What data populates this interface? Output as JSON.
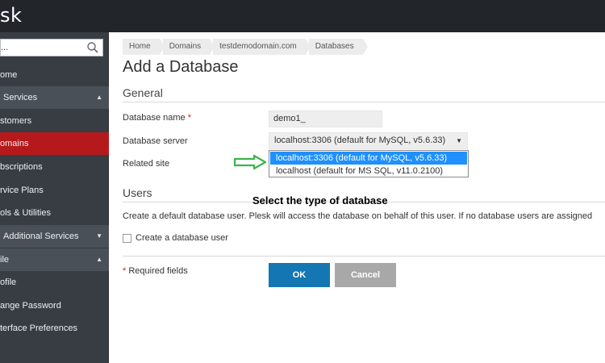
{
  "app": {
    "logo_text": "sk"
  },
  "sidebar": {
    "search": {
      "value": "...",
      "icon": "search-icon"
    },
    "items": [
      {
        "label": "ome",
        "type": "item",
        "active": false
      },
      {
        "label": "Services",
        "type": "group",
        "expanded": true
      },
      {
        "label": "stomers",
        "type": "item",
        "active": false
      },
      {
        "label": "omains",
        "type": "item",
        "active": true
      },
      {
        "label": "bscriptions",
        "type": "item",
        "active": false
      },
      {
        "label": "rvice Plans",
        "type": "item",
        "active": false
      },
      {
        "label": "ols & Utilities",
        "type": "item",
        "active": false
      },
      {
        "label": "Additional Services",
        "type": "group",
        "expanded": false
      },
      {
        "label": "ile",
        "type": "group",
        "expanded": true
      },
      {
        "label": "ofile",
        "type": "item",
        "active": false
      },
      {
        "label": "ange Password",
        "type": "item",
        "active": false
      },
      {
        "label": "terface Preferences",
        "type": "item",
        "active": false
      }
    ]
  },
  "breadcrumb": [
    "Home",
    "Domains",
    "testdemodomain.com",
    "Databases"
  ],
  "page": {
    "title": "Add a Database"
  },
  "general": {
    "heading": "General",
    "db_name_label": "Database name",
    "db_name_value": "demo1_",
    "db_server_label": "Database server",
    "db_server_value": "localhost:3306 (default for MySQL, v5.6.33)",
    "related_site_label": "Related site",
    "dropdown_options": [
      {
        "label": "localhost:3306 (default for MySQL, v5.6.33)",
        "selected": true
      },
      {
        "label": "localhost (default for MS SQL, v11.0.2100)",
        "selected": false
      }
    ],
    "required_marker": "*"
  },
  "annotation": {
    "text": "Select the type of database",
    "arrow_color": "#39b54a"
  },
  "users": {
    "heading": "Users",
    "description": "Create a default database user. Plesk will access the database on behalf of this user. If no database users are assigned",
    "checkbox_label": "Create a database user",
    "checkbox_checked": false
  },
  "footer": {
    "required_note_marker": "*",
    "required_note": "Required fields",
    "ok_label": "OK",
    "cancel_label": "Cancel"
  },
  "colors": {
    "topbar": "#22262a",
    "sidebar": "#383d43",
    "active_nav": "#b6191c",
    "ok_button": "#1477b3",
    "cancel_button": "#a8a8a8",
    "dropdown_highlight": "#1e90ff"
  }
}
